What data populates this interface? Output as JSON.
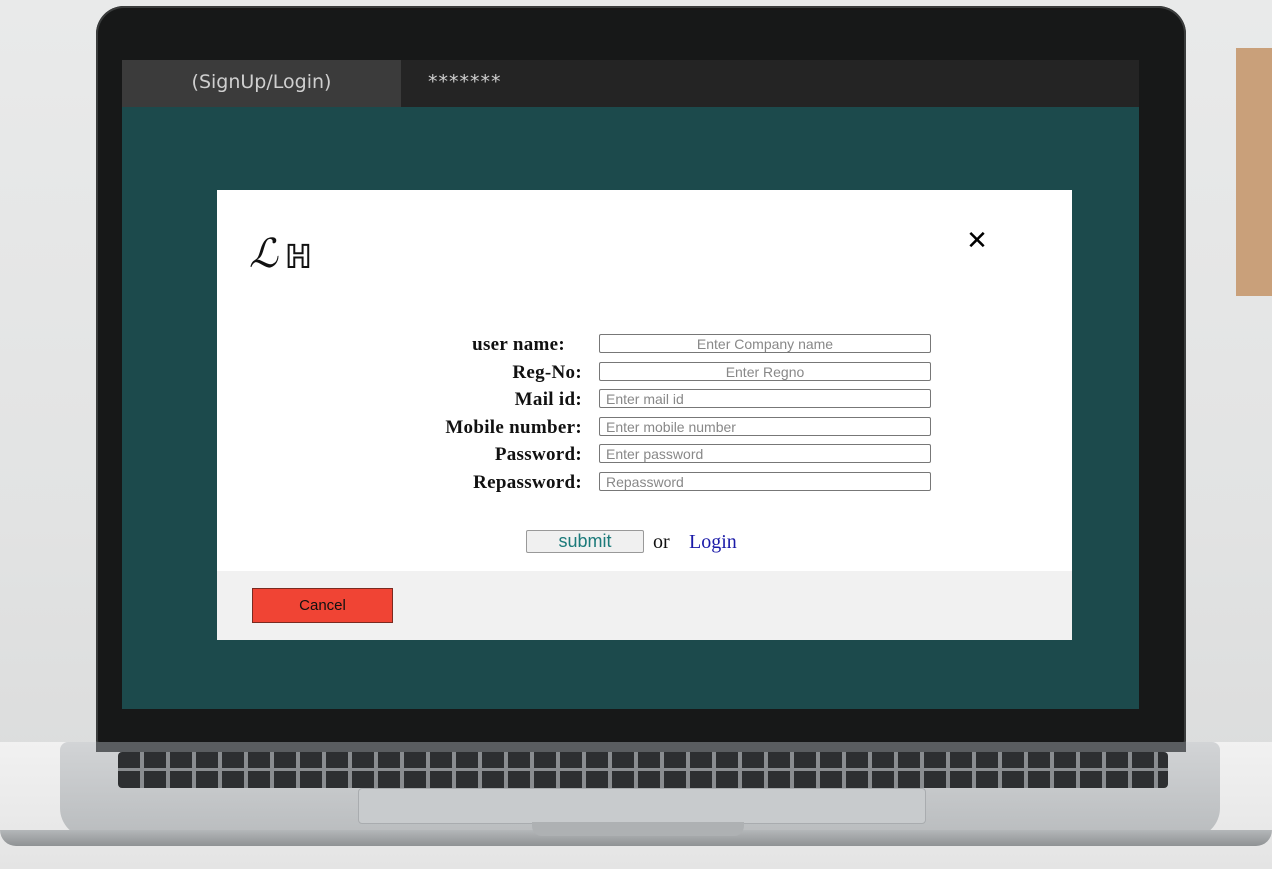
{
  "window": {
    "tabs": [
      {
        "label": "(SignUp/Login)",
        "active": true
      },
      {
        "label": "*******",
        "active": false
      }
    ]
  },
  "modal": {
    "logo": {
      "left": "ℒ",
      "right": "H"
    },
    "close_icon": "✕",
    "fields": [
      {
        "label": "user name:",
        "placeholder": "Enter Company name"
      },
      {
        "label": "Reg-No:",
        "placeholder": "Enter Regno"
      },
      {
        "label": "Mail id:",
        "placeholder": "Enter mail id"
      },
      {
        "label": "Mobile number:",
        "placeholder": "Enter mobile number"
      },
      {
        "label": "Password:",
        "placeholder": "Enter password"
      },
      {
        "label": "Repassword:",
        "placeholder": "Repassword"
      }
    ],
    "submit_label": "submit",
    "or_text": "or",
    "login_link": "Login",
    "cancel_label": "Cancel"
  },
  "colors": {
    "screen_bg": "#1c4a4c",
    "cancel_bg": "#f04434",
    "link": "#1a1aa8",
    "submit_text": "#1b7a7a"
  }
}
